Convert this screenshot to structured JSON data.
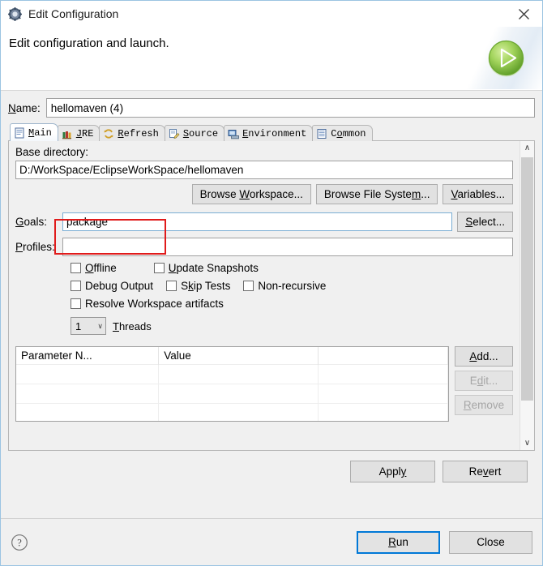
{
  "window": {
    "title": "Edit Configuration",
    "icon": "configuration-gear-icon",
    "close_label": "✕"
  },
  "header": {
    "message": "Edit configuration and launch.",
    "badge_icon": "green-run-play-icon"
  },
  "name_field": {
    "label": "Name:",
    "mnemonic": "N",
    "value": "hellomaven (4)"
  },
  "tabs": [
    {
      "label": "Main",
      "mnemonic": "M",
      "icon": "main-document-icon",
      "active": true
    },
    {
      "label": "JRE",
      "mnemonic": "J",
      "icon": "jre-books-icon",
      "active": false
    },
    {
      "label": "Refresh",
      "mnemonic": "R",
      "icon": "refresh-arrows-icon",
      "active": false
    },
    {
      "label": "Source",
      "mnemonic": "S",
      "icon": "source-edit-icon",
      "active": false
    },
    {
      "label": "Environment",
      "mnemonic": "E",
      "icon": "environment-icon",
      "active": false
    },
    {
      "label": "Common",
      "mnemonic": "o",
      "icon": "common-list-icon",
      "active": false
    }
  ],
  "main_tab": {
    "base_directory": {
      "label": "Base directory:",
      "value": "D:/WorkSpace/EclipseWorkSpace/hellomaven",
      "buttons": [
        {
          "label": "Browse Workspace...",
          "mnemonic": "W"
        },
        {
          "label": "Browse File System...",
          "mnemonic": "m"
        },
        {
          "label": "Variables...",
          "mnemonic": "V"
        }
      ]
    },
    "goals": {
      "label": "Goals:",
      "mnemonic": "G",
      "value": "package",
      "select_button": "Select...",
      "select_mnemonic": "S",
      "focused": true,
      "annotated": true,
      "annotation_color": "#e01b1b"
    },
    "profiles": {
      "label": "Profiles:",
      "mnemonic": "P",
      "value": "",
      "placeholder": ""
    },
    "checkboxes": [
      {
        "label": "Offline",
        "mnemonic": "O",
        "checked": false
      },
      {
        "label": "Update Snapshots",
        "mnemonic": "U",
        "checked": false
      },
      {
        "label": "Debug Output",
        "mnemonic": "",
        "checked": false
      },
      {
        "label": "Skip Tests",
        "mnemonic": "k",
        "checked": false
      },
      {
        "label": "Non-recursive",
        "mnemonic": "",
        "checked": false
      },
      {
        "label": "Resolve Workspace artifacts",
        "mnemonic": "",
        "checked": false
      }
    ],
    "threads": {
      "value": "1",
      "label": "Threads",
      "mnemonic": "T",
      "chevron": "∨"
    },
    "parameter_table": {
      "columns": [
        "Parameter N...",
        "Value",
        ""
      ],
      "rows": [],
      "empty_row_count": 3,
      "buttons": [
        {
          "label": "Add...",
          "mnemonic": "A",
          "enabled": true
        },
        {
          "label": "Edit...",
          "mnemonic": "d",
          "enabled": false
        },
        {
          "label": "Remove",
          "mnemonic": "R",
          "enabled": false
        }
      ]
    },
    "scrollbar": {
      "up_arrow": "∧",
      "down_arrow": "∨"
    }
  },
  "apply_row": [
    {
      "label": "Apply",
      "mnemonic": "y"
    },
    {
      "label": "Revert",
      "mnemonic": "v"
    }
  ],
  "footer": {
    "help_icon": "help-question-icon",
    "buttons": [
      {
        "label": "Run",
        "mnemonic": "R",
        "default": true
      },
      {
        "label": "Close",
        "mnemonic": "",
        "default": false
      }
    ]
  },
  "colors": {
    "accent_focus": "#0078d7",
    "annotation": "#e01b1b",
    "dialog_bg": "#f0f0f0",
    "header_bg": "#ffffff",
    "run_badge_green": "#7cc043"
  }
}
